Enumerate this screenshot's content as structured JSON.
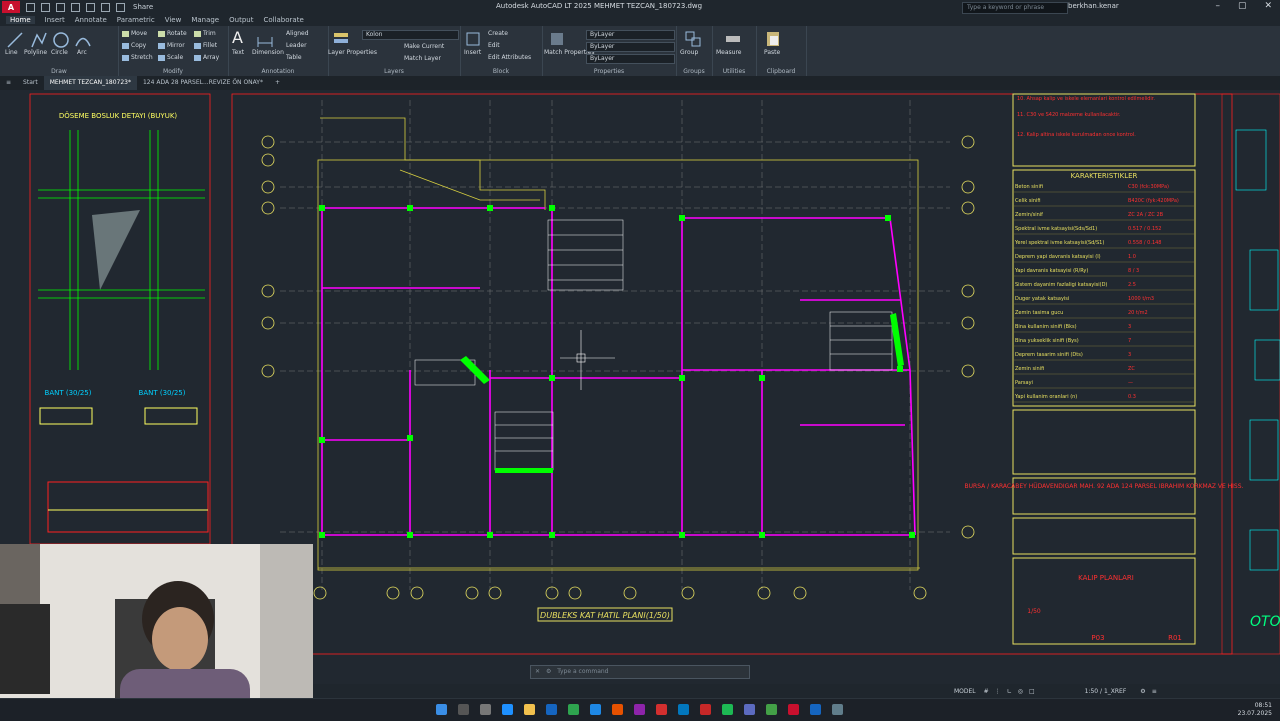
{
  "app": {
    "badge": "A",
    "title": "Autodesk AutoCAD LT 2025   MEHMET TEZCAN_180723.dwg",
    "share": "Share"
  },
  "search": {
    "placeholder": "Type a keyword or phrase"
  },
  "user": {
    "name": "berkhan.kenar"
  },
  "menu_tabs": [
    "Home",
    "Insert",
    "Annotate",
    "Parametric",
    "View",
    "Manage",
    "Output",
    "Collaborate"
  ],
  "ribbon": {
    "draw": {
      "title": "Draw",
      "tools": [
        "Line",
        "Polyline",
        "Circle",
        "Arc"
      ]
    },
    "modify": {
      "title": "Modify",
      "tools": [
        "Move",
        "Rotate",
        "Trim",
        "Copy",
        "Mirror",
        "Fillet",
        "Stretch",
        "Scale",
        "Array"
      ]
    },
    "annotation": {
      "title": "Annotation",
      "tools": [
        "Text",
        "Dimension",
        "Aligned",
        "Leader",
        "Table"
      ]
    },
    "layers": {
      "title": "Layers",
      "tools": [
        "Layer Properties",
        "Make Current",
        "Match Layer"
      ],
      "current_layer": "Kolon"
    },
    "block": {
      "title": "Block",
      "tools": [
        "Insert",
        "Create",
        "Edit",
        "Edit Attributes"
      ]
    },
    "properties": {
      "title": "Properties",
      "tools": [
        "Match Properties"
      ],
      "color": "ByLayer",
      "linetype": "ByLayer",
      "lineweight": "ByLayer"
    },
    "groups": {
      "title": "Groups",
      "tools": [
        "Group"
      ]
    },
    "utilities": {
      "title": "Utilities",
      "tools": [
        "Measure"
      ]
    },
    "clipboard": {
      "title": "Clipboard",
      "tools": [
        "Paste"
      ]
    }
  },
  "file_tabs": [
    "Start",
    "MEHMET TEZCAN_180723*",
    "124 ADA 28 PARSEL...REVIZE ÖN ONAY*"
  ],
  "drawing": {
    "left_title": "DÖSEME BOSLUK DETAYI (BUYUK)",
    "bant1": "BANT (30/25)",
    "bant2": "BANT (30/25)",
    "plan_title": "DUBLEKS KAT HATIL PLANI(1/50)",
    "notes": [
      "10. Ahsap kalip ve iskele elemanlari kontrol edilmelidir.",
      "11. C30 ve S420 malzeme kullanilacaktir.",
      "12. Kalip altina iskele kurulmadan once kontrol."
    ],
    "char_title": "KARAKTERISTIKLER",
    "char_rows": [
      "Beton sinifi",
      "Celik sinifi",
      "Zemin/sinif",
      "Spektral ivme katsayisi(Sds/Sd1)",
      "Yerel spektral ivme katsayisi(Sd/S1)",
      "Deprem yapi davranis katsayisi (I)",
      "Yapi davranis katsayisi (R/Ry)",
      "Sistem dayanim fazlaligi katsayisi(D)",
      "Duger yatak katsayisi",
      "Zemin tasima gucu",
      "Bina kullanim sinifi (Bks)",
      "Bina yukseklik sinifi (Bys)",
      "Deprem tasarim sinifi (Dts)",
      "Zemin sinifi",
      "Parsayi",
      "Yapi kullanim oranlari (n)"
    ],
    "char_vals": [
      "C30 (fck:30MPa)",
      "B420C (fyk:420MPa)",
      "ZC 2A / ZC 2B",
      "0.517 / 0.152",
      "0.558 / 0.148",
      "1.0",
      "8 / 3",
      "2.5",
      "1000 t/m3",
      "20 t/m2",
      "3",
      "7",
      "3",
      "ZC",
      "—",
      "0.3"
    ],
    "project_red": "BURSA / KARACABEY HÜDAVENDIGAR MAH. 92 ADA 124 PARSEL IBRAHIM KORKMAZ VE HISS.",
    "sheet_name": "KALIP PLANLARI",
    "scale": "1/50",
    "sheet_no": "P03",
    "rev": "R01",
    "right_text": "OTO",
    "grid_labels": [
      "1",
      "2",
      "3",
      "4",
      "5",
      "6",
      "7",
      "8",
      "9",
      "10",
      "11",
      "12",
      "13",
      "14"
    ]
  },
  "command": {
    "placeholder": "Type a command"
  },
  "status": {
    "model": "MODEL",
    "scale": "1:50 / 1_XREF"
  },
  "clock": {
    "time": "08:51",
    "date": "23.07.2025"
  },
  "colors": {
    "magenta": "#ff00ff",
    "green": "#00ff00",
    "yellow": "#d8d040",
    "red": "#ff2020",
    "cyan": "#00ffff",
    "bg": "#212830"
  }
}
